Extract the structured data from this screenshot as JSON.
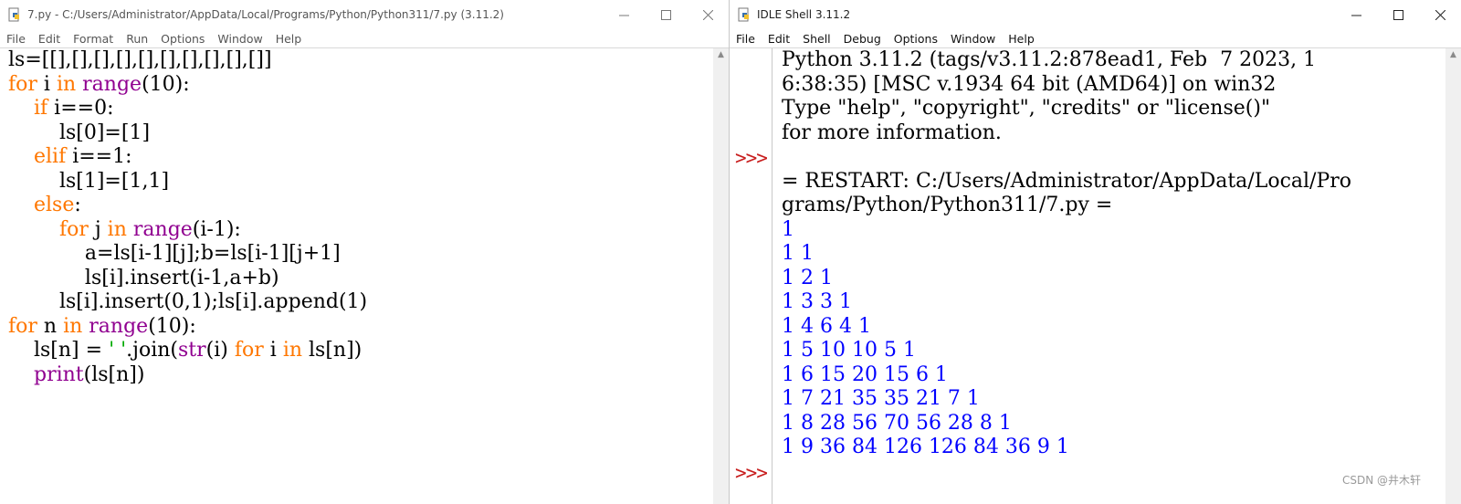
{
  "editor": {
    "title": "7.py - C:/Users/Administrator/AppData/Local/Programs/Python/Python311/7.py (3.11.2)",
    "menu": [
      "File",
      "Edit",
      "Format",
      "Run",
      "Options",
      "Window",
      "Help"
    ],
    "code_lines": [
      [
        {
          "t": "ls=[[],[],[],[],[],[],[],[],[],[]]",
          "c": ""
        }
      ],
      [
        {
          "t": "for",
          "c": "kw"
        },
        {
          "t": " i ",
          "c": ""
        },
        {
          "t": "in",
          "c": "kw"
        },
        {
          "t": " ",
          "c": ""
        },
        {
          "t": "range",
          "c": "bi"
        },
        {
          "t": "(10):",
          "c": ""
        }
      ],
      [
        {
          "t": "    ",
          "c": ""
        },
        {
          "t": "if",
          "c": "kw"
        },
        {
          "t": " i==0:",
          "c": ""
        }
      ],
      [
        {
          "t": "        ls[0]=[1]",
          "c": ""
        }
      ],
      [
        {
          "t": "    ",
          "c": ""
        },
        {
          "t": "elif",
          "c": "kw"
        },
        {
          "t": " i==1:",
          "c": ""
        }
      ],
      [
        {
          "t": "        ls[1]=[1,1]",
          "c": ""
        }
      ],
      [
        {
          "t": "    ",
          "c": ""
        },
        {
          "t": "else",
          "c": "kw"
        },
        {
          "t": ":",
          "c": ""
        }
      ],
      [
        {
          "t": "        ",
          "c": ""
        },
        {
          "t": "for",
          "c": "kw"
        },
        {
          "t": " j ",
          "c": ""
        },
        {
          "t": "in",
          "c": "kw"
        },
        {
          "t": " ",
          "c": ""
        },
        {
          "t": "range",
          "c": "bi"
        },
        {
          "t": "(i-1):",
          "c": ""
        }
      ],
      [
        {
          "t": "            a=ls[i-1][j];b=ls[i-1][j+1]",
          "c": ""
        }
      ],
      [
        {
          "t": "            ls[i].insert(i-1,a+b)",
          "c": ""
        }
      ],
      [
        {
          "t": "        ls[i].insert(0,1);ls[i].append(1)",
          "c": ""
        }
      ],
      [
        {
          "t": "for",
          "c": "kw"
        },
        {
          "t": " n ",
          "c": ""
        },
        {
          "t": "in",
          "c": "kw"
        },
        {
          "t": " ",
          "c": ""
        },
        {
          "t": "range",
          "c": "bi"
        },
        {
          "t": "(10):",
          "c": ""
        }
      ],
      [
        {
          "t": "    ls[n] = ",
          "c": ""
        },
        {
          "t": "' '",
          "c": "st"
        },
        {
          "t": ".join(",
          "c": ""
        },
        {
          "t": "str",
          "c": "bi"
        },
        {
          "t": "(i) ",
          "c": ""
        },
        {
          "t": "for",
          "c": "kw"
        },
        {
          "t": " i ",
          "c": ""
        },
        {
          "t": "in",
          "c": "kw"
        },
        {
          "t": " ls[n])",
          "c": ""
        }
      ],
      [
        {
          "t": "    ",
          "c": ""
        },
        {
          "t": "print",
          "c": "bi"
        },
        {
          "t": "(ls[n])",
          "c": ""
        }
      ]
    ]
  },
  "shell": {
    "title": "IDLE Shell 3.11.2",
    "menu": [
      "File",
      "Edit",
      "Shell",
      "Debug",
      "Options",
      "Window",
      "Help"
    ],
    "prompt": ">>>",
    "lines": [
      {
        "t": "Python 3.11.2 (tags/v3.11.2:878ead1, Feb  7 2023, 1",
        "c": ""
      },
      {
        "t": "6:38:35) [MSC v.1934 64 bit (AMD64)] on win32",
        "c": ""
      },
      {
        "t": "Type \"help\", \"copyright\", \"credits\" or \"license()\"",
        "c": ""
      },
      {
        "t": "for more information.",
        "c": ""
      },
      {
        "t": "",
        "c": "",
        "prompt": true
      },
      {
        "t": "= RESTART: C:/Users/Administrator/AppData/Local/Pro",
        "c": ""
      },
      {
        "t": "grams/Python/Python311/7.py =",
        "c": ""
      },
      {
        "t": "1",
        "c": "out"
      },
      {
        "t": "1 1",
        "c": "out"
      },
      {
        "t": "1 2 1",
        "c": "out"
      },
      {
        "t": "1 3 3 1",
        "c": "out"
      },
      {
        "t": "1 4 6 4 1",
        "c": "out"
      },
      {
        "t": "1 5 10 10 5 1",
        "c": "out"
      },
      {
        "t": "1 6 15 20 15 6 1",
        "c": "out"
      },
      {
        "t": "1 7 21 35 35 21 7 1",
        "c": "out"
      },
      {
        "t": "1 8 28 56 70 56 28 8 1",
        "c": "out"
      },
      {
        "t": "1 9 36 84 126 126 84 36 9 1",
        "c": "out"
      },
      {
        "t": "",
        "c": "",
        "prompt": true
      }
    ]
  },
  "watermark": "CSDN @井木轩"
}
